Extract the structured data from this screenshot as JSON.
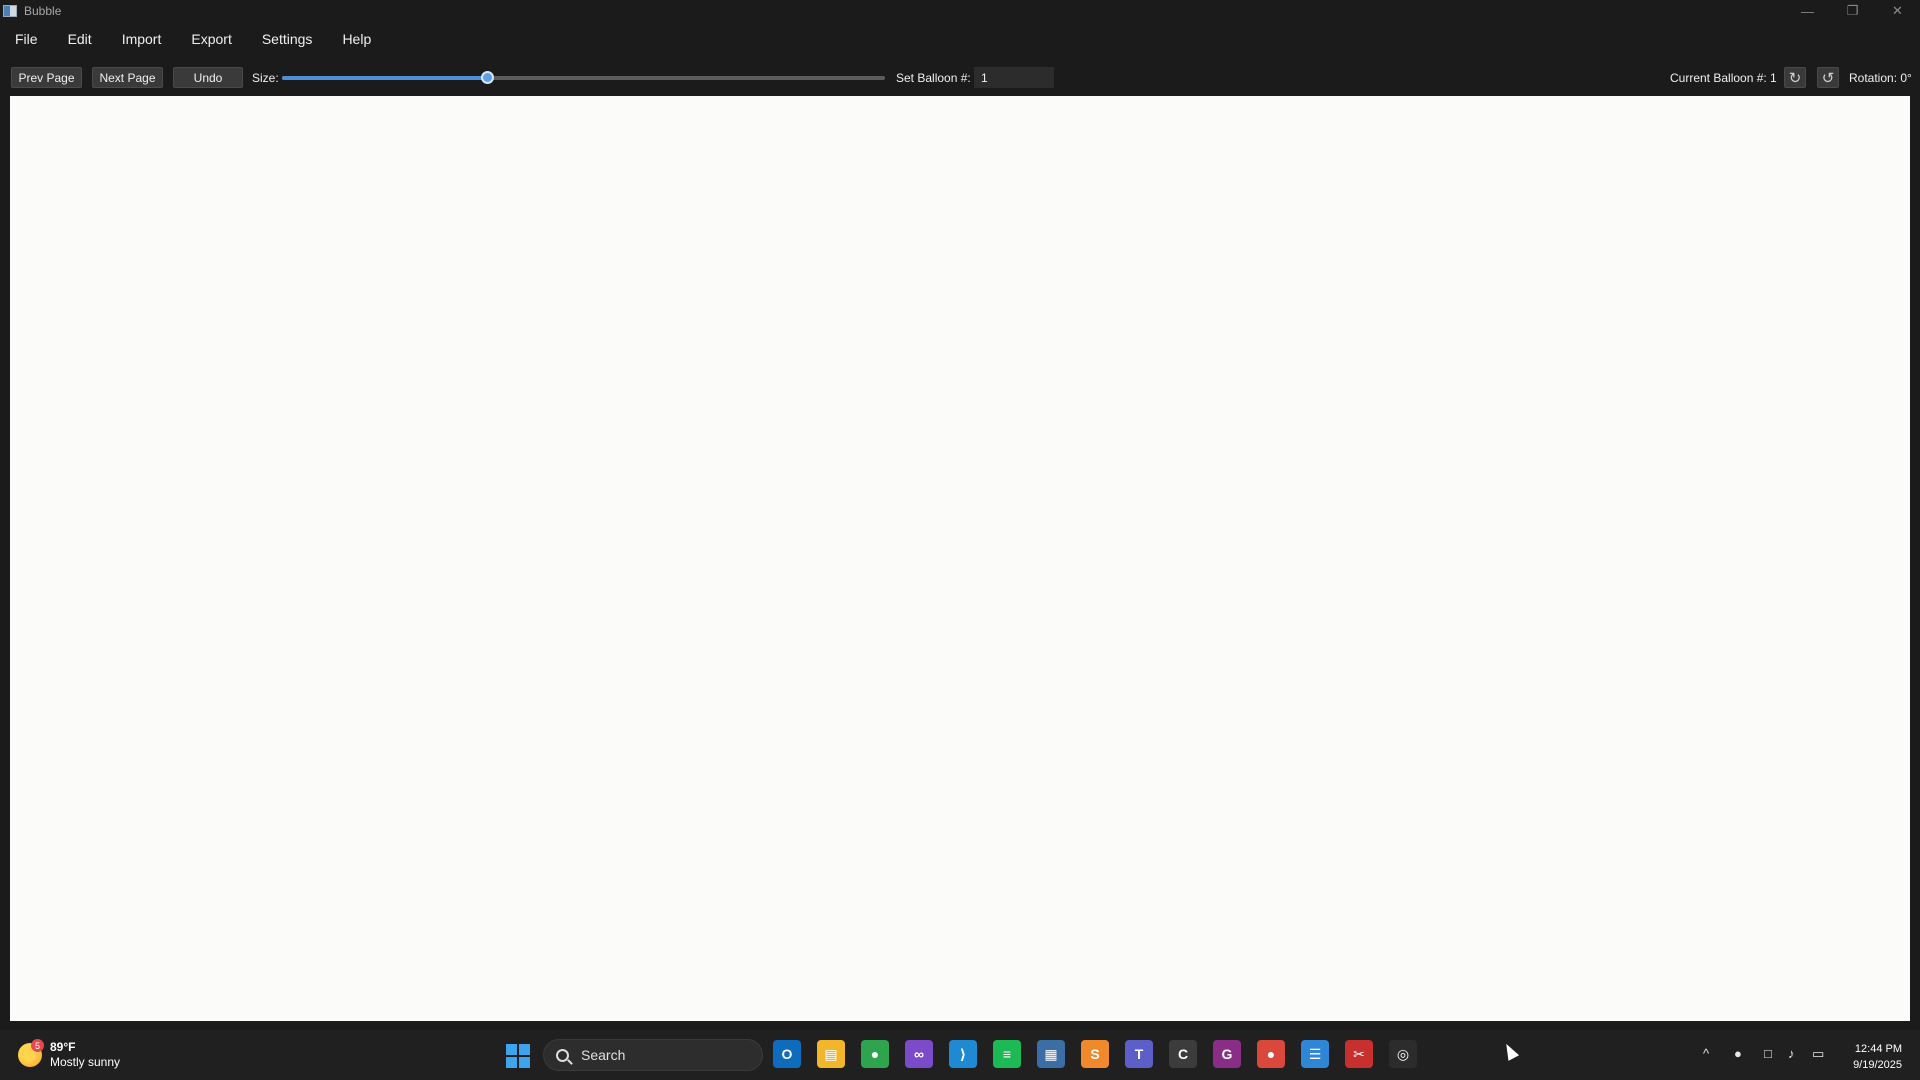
{
  "window": {
    "title": "Bubble",
    "controls": {
      "minimize": "—",
      "maximize": "❐",
      "close": "✕"
    }
  },
  "menu": {
    "items": [
      "File",
      "Edit",
      "Import",
      "Export",
      "Settings",
      "Help"
    ]
  },
  "toolbar": {
    "prev_page": "Prev Page",
    "next_page": "Next Page",
    "undo": "Undo",
    "size_label": "Size:",
    "size_fraction": 0.34,
    "set_balloon_label": "Set Balloon #:",
    "set_balloon_value": "1",
    "current_balloon_label": "Current Balloon #: 1",
    "rotate_cw_glyph": "↻",
    "rotate_ccw_glyph": "↺",
    "rotation_label": "Rotation: 0°"
  },
  "taskbar": {
    "weather": {
      "badge": "5",
      "temp": "89°F",
      "desc": "Mostly sunny",
      "icon": "sun-icon"
    },
    "search_placeholder": "Search",
    "apps": [
      {
        "name": "outlook-icon",
        "glyph": "O",
        "color": "#0f6cbd"
      },
      {
        "name": "file-explorer-icon",
        "glyph": "▤",
        "color": "#f2b62b"
      },
      {
        "name": "chrome-icon",
        "glyph": "●",
        "color": "#2ea44f"
      },
      {
        "name": "visual-studio-icon",
        "glyph": "∞",
        "color": "#7b4bc9"
      },
      {
        "name": "vscode-icon",
        "glyph": "⟩",
        "color": "#1f8ad2"
      },
      {
        "name": "spotify-icon",
        "glyph": "≡",
        "color": "#1db954"
      },
      {
        "name": "calculator-icon",
        "glyph": "▦",
        "color": "#3a6ea5"
      },
      {
        "name": "sublime-icon",
        "glyph": "S",
        "color": "#f0892b"
      },
      {
        "name": "teams-icon",
        "glyph": "T",
        "color": "#5b5fc7"
      },
      {
        "name": "codex-icon",
        "glyph": "C",
        "color": "#3c3c3c"
      },
      {
        "name": "pdf-editor-icon",
        "glyph": "G",
        "color": "#8a2d86"
      },
      {
        "name": "chrome-profile-icon",
        "glyph": "●",
        "color": "#d9483b"
      },
      {
        "name": "notepad-icon",
        "glyph": "☰",
        "color": "#2f86d6"
      },
      {
        "name": "snipping-tool-icon",
        "glyph": "✂",
        "color": "#c8302e"
      },
      {
        "name": "aperture-icon",
        "glyph": "◎",
        "color": "#2c2c2c"
      }
    ],
    "tray": {
      "chevron": "^",
      "mic": "●",
      "network": "□",
      "volume": "♪",
      "battery": "▭"
    },
    "time": "12:44 PM",
    "date": "9/19/2025"
  }
}
